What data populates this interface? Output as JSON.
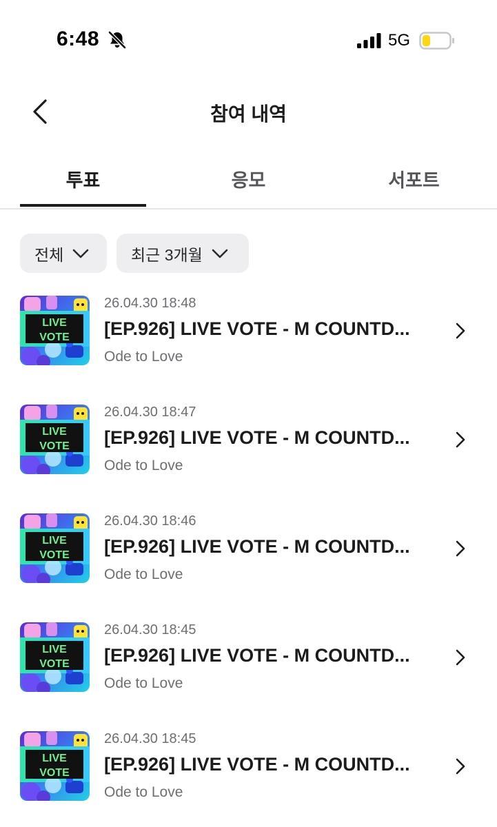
{
  "status_bar": {
    "time": "6:48",
    "network": "5G",
    "icons": [
      "bell-slash-icon",
      "signal-icon",
      "battery-icon"
    ],
    "battery_color": "#ffd60a"
  },
  "header": {
    "title": "참여 내역",
    "back_icon": "chevron-left-icon"
  },
  "tabs": [
    {
      "label": "투표",
      "active": true
    },
    {
      "label": "응모",
      "active": false
    },
    {
      "label": "서포트",
      "active": false
    }
  ],
  "filters": [
    {
      "label": "전체",
      "icon": "chevron-down-icon"
    },
    {
      "label": "최근 3개월",
      "icon": "chevron-down-icon"
    }
  ],
  "thumbnail_text": {
    "line1": "LIVE",
    "line2": "VOTE"
  },
  "items": [
    {
      "date": "26.04.30 18:48",
      "title": "[EP.926] LIVE VOTE - M COUNTD...",
      "subtitle": "Ode to Love"
    },
    {
      "date": "26.04.30 18:47",
      "title": "[EP.926] LIVE VOTE - M COUNTD...",
      "subtitle": "Ode to Love"
    },
    {
      "date": "26.04.30 18:46",
      "title": "[EP.926] LIVE VOTE - M COUNTD...",
      "subtitle": "Ode to Love"
    },
    {
      "date": "26.04.30 18:45",
      "title": "[EP.926] LIVE VOTE - M COUNTD...",
      "subtitle": "Ode to Love"
    },
    {
      "date": "26.04.30 18:45",
      "title": "[EP.926] LIVE VOTE - M COUNTD...",
      "subtitle": "Ode to Love"
    }
  ],
  "colors": {
    "text_primary": "#1c1c1e",
    "text_secondary": "#6e6e73",
    "chip_background": "#eeeef1",
    "divider": "#e6e6e9"
  }
}
